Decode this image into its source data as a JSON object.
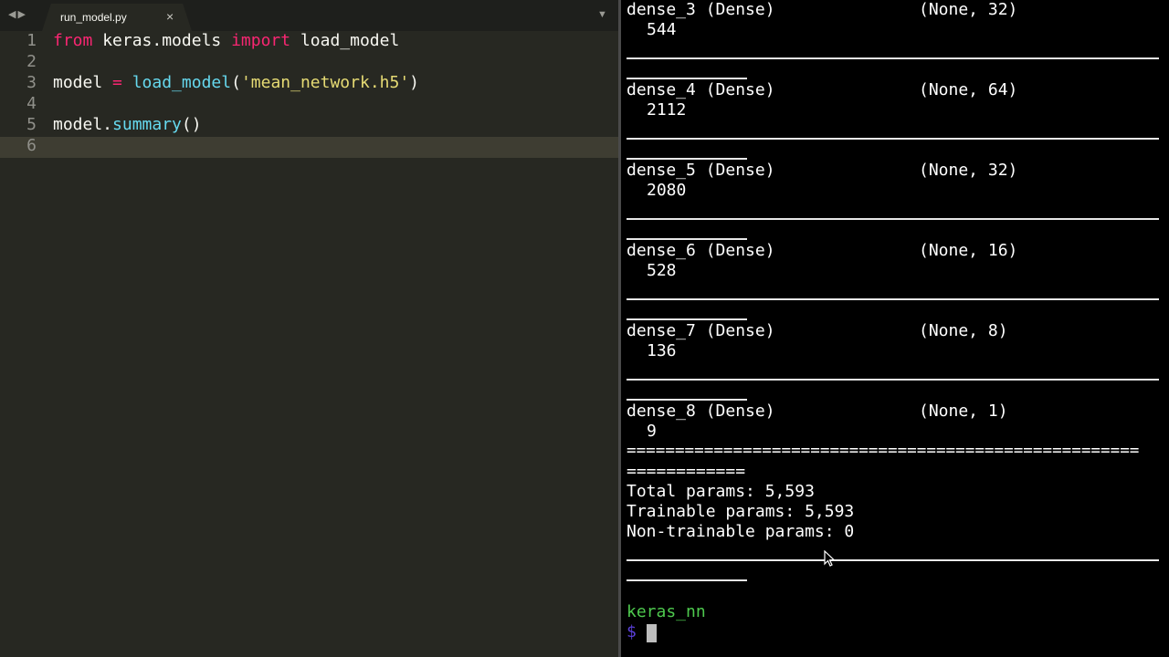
{
  "editor": {
    "tab": {
      "filename": "run_model.py",
      "close_glyph": "×"
    },
    "nav": {
      "back_glyph": "◀",
      "forward_glyph": "▶"
    },
    "dropdown_glyph": "▼",
    "line_numbers": [
      "1",
      "2",
      "3",
      "4",
      "5",
      "6"
    ],
    "code": {
      "l1_from": "from",
      "l1_module": " keras.models ",
      "l1_import": "import",
      "l1_name": " load_model",
      "l3_var": "model ",
      "l3_eq": "=",
      "l3_fn": " load_model",
      "l3_open": "(",
      "l3_str": "'mean_network.h5'",
      "l3_close": ")",
      "l5_obj": "model.",
      "l5_fn": "summary",
      "l5_parens": "()"
    }
  },
  "terminal": {
    "layers": [
      {
        "name": "dense_3 (Dense)",
        "shape": "(None, 32)",
        "params": "544"
      },
      {
        "name": "dense_4 (Dense)",
        "shape": "(None, 64)",
        "params": "2112"
      },
      {
        "name": "dense_5 (Dense)",
        "shape": "(None, 32)",
        "params": "2080"
      },
      {
        "name": "dense_6 (Dense)",
        "shape": "(None, 16)",
        "params": "528"
      },
      {
        "name": "dense_7 (Dense)",
        "shape": "(None, 8)",
        "params": "136"
      },
      {
        "name": "dense_8 (Dense)",
        "shape": "(None, 1)",
        "params": "9"
      }
    ],
    "double_rule": "=====================================================",
    "double_rule_short": "============",
    "total_params": "Total params: 5,593",
    "trainable_params": "Trainable params: 5,593",
    "non_trainable_params": "Non-trainable params: 0",
    "prompt_dir": "keras_nn",
    "prompt_symbol": "$"
  }
}
